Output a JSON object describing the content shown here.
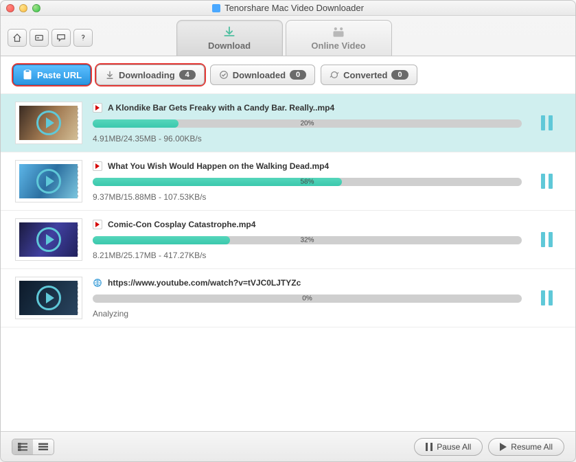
{
  "window": {
    "title": "Tenorshare Mac Video Downloader"
  },
  "tabs": {
    "download": "Download",
    "online_video": "Online Video"
  },
  "actions": {
    "paste_url": "Paste URL",
    "downloading": {
      "label": "Downloading",
      "count": "4"
    },
    "downloaded": {
      "label": "Downloaded",
      "count": "0"
    },
    "converted": {
      "label": "Converted",
      "count": "0"
    }
  },
  "downloads": [
    {
      "title": "A Klondike Bar Gets Freaky with a Candy Bar. Really..mp4",
      "progress_text": "20%",
      "progress_style": "width:20%",
      "meta": "4.91MB/24.35MB - 96.00KB/s"
    },
    {
      "title": "What You Wish Would Happen on the Walking Dead.mp4",
      "progress_text": "58%",
      "progress_style": "width:58%",
      "meta": "9.37MB/15.88MB - 107.53KB/s"
    },
    {
      "title": "Comic-Con Cosplay Catastrophe.mp4",
      "progress_text": "32%",
      "progress_style": "width:32%",
      "meta": "8.21MB/25.17MB - 417.27KB/s"
    },
    {
      "title": "https://www.youtube.com/watch?v=tVJC0LJTYZc",
      "progress_text": "0%",
      "progress_style": "width:0%",
      "meta": "Analyzing"
    }
  ],
  "footer": {
    "pause_all": "Pause All",
    "resume_all": "Resume All"
  }
}
